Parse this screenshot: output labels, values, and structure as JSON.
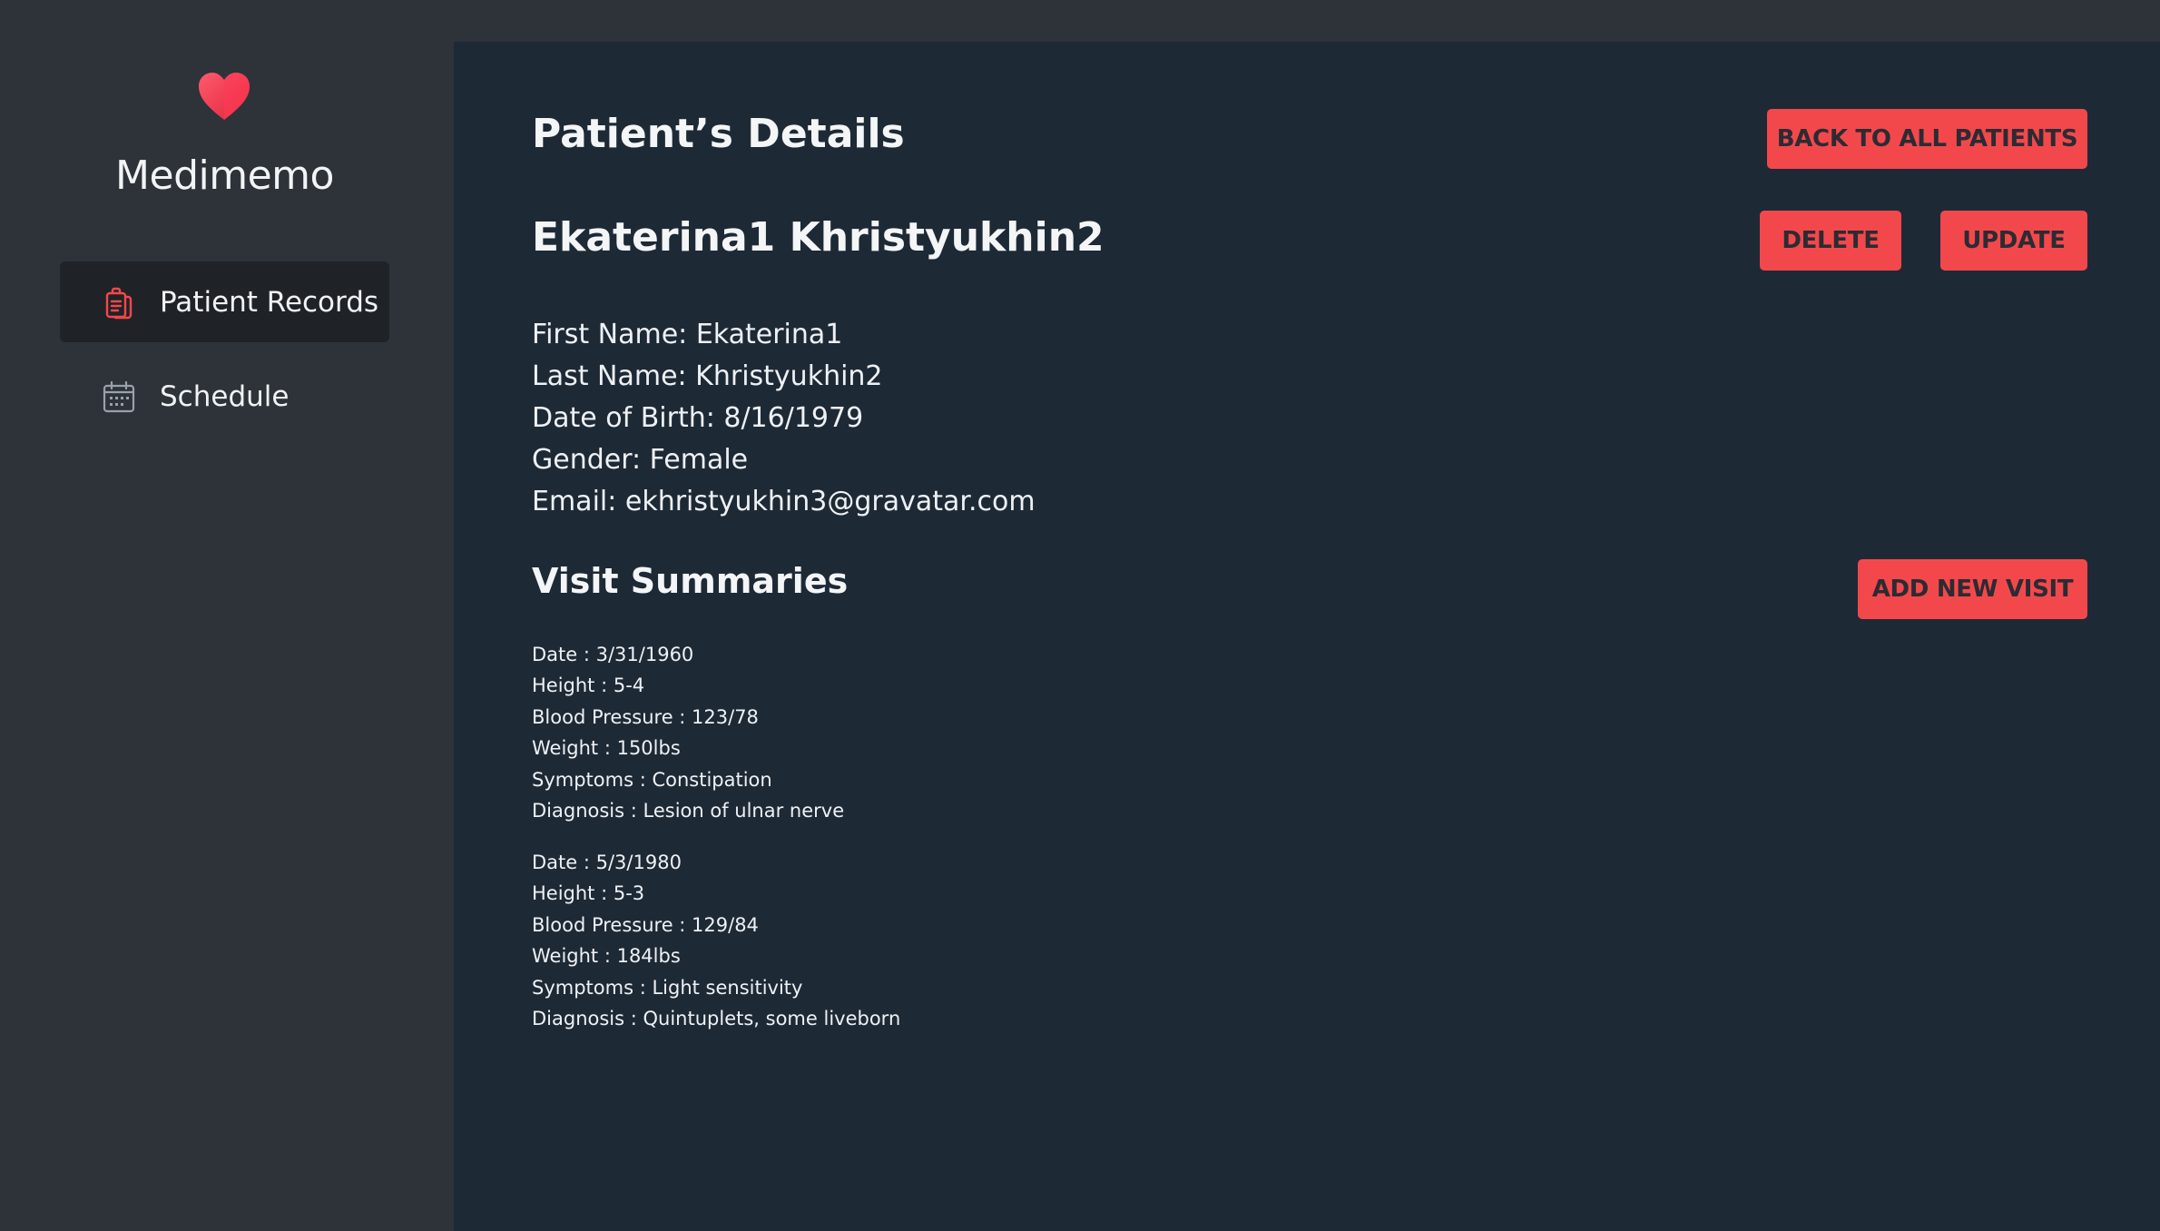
{
  "app": {
    "name": "Medimemo",
    "accent_color": "#f3484b",
    "logo_icon": "heart-icon"
  },
  "sidebar": {
    "items": [
      {
        "label": "Patient Records",
        "icon": "clipboard-icon",
        "active": true
      },
      {
        "label": "Schedule",
        "icon": "calendar-icon",
        "active": false
      }
    ]
  },
  "page": {
    "title": "Patient’s Details",
    "back_button": "BACK TO ALL PATIENTS"
  },
  "patient": {
    "full_name": "Ekaterina1 Khristyukhin2",
    "delete_button": "DELETE",
    "update_button": "UPDATE",
    "first_name": "First Name: Ekaterina1",
    "last_name": "Last Name: Khristyukhin2",
    "dob": "Date of Birth: 8/16/1979",
    "gender": "Gender: Female",
    "email": "Email: ekhristyukhin3@gravatar.com"
  },
  "visits": {
    "title": "Visit Summaries",
    "add_button": "ADD NEW VISIT",
    "items": [
      {
        "date": "Date : 3/31/1960",
        "height": "Height : 5-4",
        "blood_pressure": "Blood Pressure : 123/78",
        "weight": "Weight : 150lbs",
        "symptoms": "Symptoms : Constipation",
        "diagnosis": "Diagnosis : Lesion of ulnar nerve"
      },
      {
        "date": "Date : 5/3/1980",
        "height": "Height : 5-3",
        "blood_pressure": "Blood Pressure : 129/84",
        "weight": "Weight : 184lbs",
        "symptoms": "Symptoms : Light sensitivity",
        "diagnosis": "Diagnosis : Quintuplets, some liveborn"
      }
    ]
  }
}
